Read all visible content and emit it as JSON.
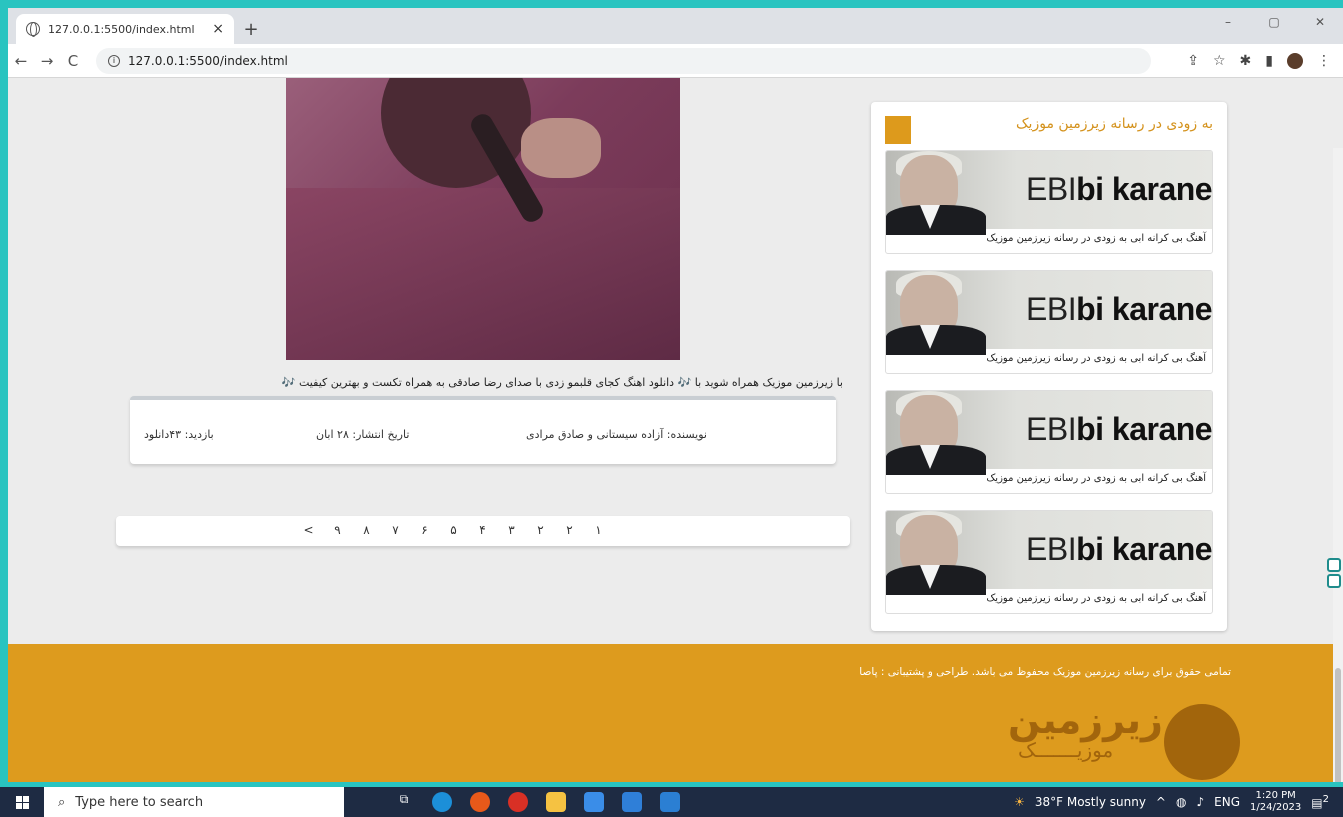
{
  "browser": {
    "tab_title": "127.0.0.1:5500/index.html",
    "tab_close": "×",
    "new_tab": "+",
    "url": "127.0.0.1:5500/index.html",
    "back": "←",
    "forward": "→",
    "reload": "C",
    "win_min": "–",
    "win_max": "▢",
    "win_close": "✕"
  },
  "post": {
    "description": "با زیرزمین موزیک همراه شوید با 🎶 دانلود اهنگ کجای قلبمو زدی با صدای رضا صادقی به همراه تکست و بهترین کیفیت 🎶",
    "author": "نویسنده: آزاده سیستانی و صادق مرادی",
    "date": "تاریخ انتشار: ۲۸ ابان",
    "views": "بازدید: ۴۳دانلود"
  },
  "pagination": [
    "<",
    "۹",
    "۸",
    "۷",
    "۶",
    "۵",
    "۴",
    "۳",
    "۲",
    "۲",
    "۱"
  ],
  "sidebar": {
    "title": "به زودی در رسانه زیرزمین موزیک",
    "cards": [
      {
        "brand_thin": "EBI",
        "brand_bold": "bi karane",
        "caption": "آهنگ بی کرانه ابی به زودی در رسانه زیرزمین موزیک"
      },
      {
        "brand_thin": "EBI",
        "brand_bold": "bi karane",
        "caption": "آهنگ بی کرانه ابی به زودی در رسانه زیرزمین موزیک"
      },
      {
        "brand_thin": "EBI",
        "brand_bold": "bi karane",
        "caption": "آهنگ بی کرانه ابی به زودی در رسانه زیرزمین موزیک"
      },
      {
        "brand_thin": "EBI",
        "brand_bold": "bi karane",
        "caption": "آهنگ بی کرانه ابی به زودی در رسانه زیرزمین موزیک"
      }
    ]
  },
  "footer": {
    "copyright": "تمامی حقوق برای رسانه زیرزمین موزیک محفوظ می باشد. طراحی و پشتیبانی : پاصا",
    "logo_main": "زیرزمین",
    "logo_sub": "موزیـــــــک"
  },
  "taskbar": {
    "search_placeholder": "Type here to search",
    "weather": "38°F  Mostly sunny",
    "lang": "ENG",
    "time": "1:20 PM",
    "date": "1/24/2023",
    "notif_count": "2"
  },
  "colors": {
    "accent": "#dd9b1e",
    "logo": "#a2650c"
  }
}
